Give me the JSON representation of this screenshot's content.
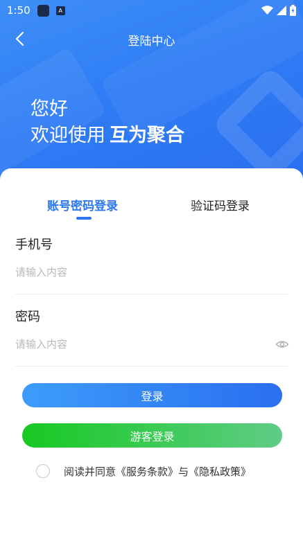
{
  "status_bar": {
    "time": "1:50",
    "app_icon_2": "A"
  },
  "nav": {
    "title": "登陆中心"
  },
  "greeting": {
    "line1": "您好",
    "line2_prefix": "欢迎使用",
    "brand": "互为聚合"
  },
  "tabs": [
    {
      "label": "账号密码登录",
      "active": true
    },
    {
      "label": "验证码登录",
      "active": false
    }
  ],
  "form": {
    "phone_label": "手机号",
    "phone_placeholder": "请输入内容",
    "phone_value": "",
    "password_label": "密码",
    "password_placeholder": "请输入内容",
    "password_value": ""
  },
  "buttons": {
    "login": "登录",
    "guest_login": "游客登录"
  },
  "agreement": {
    "prefix": "阅读并同意",
    "terms": "《服务条款》",
    "and": "与",
    "privacy": "《隐私政策》",
    "checked": false
  },
  "colors": {
    "accent": "#2a77f0",
    "guest_start": "#17c922",
    "guest_end": "#5fcc85"
  }
}
